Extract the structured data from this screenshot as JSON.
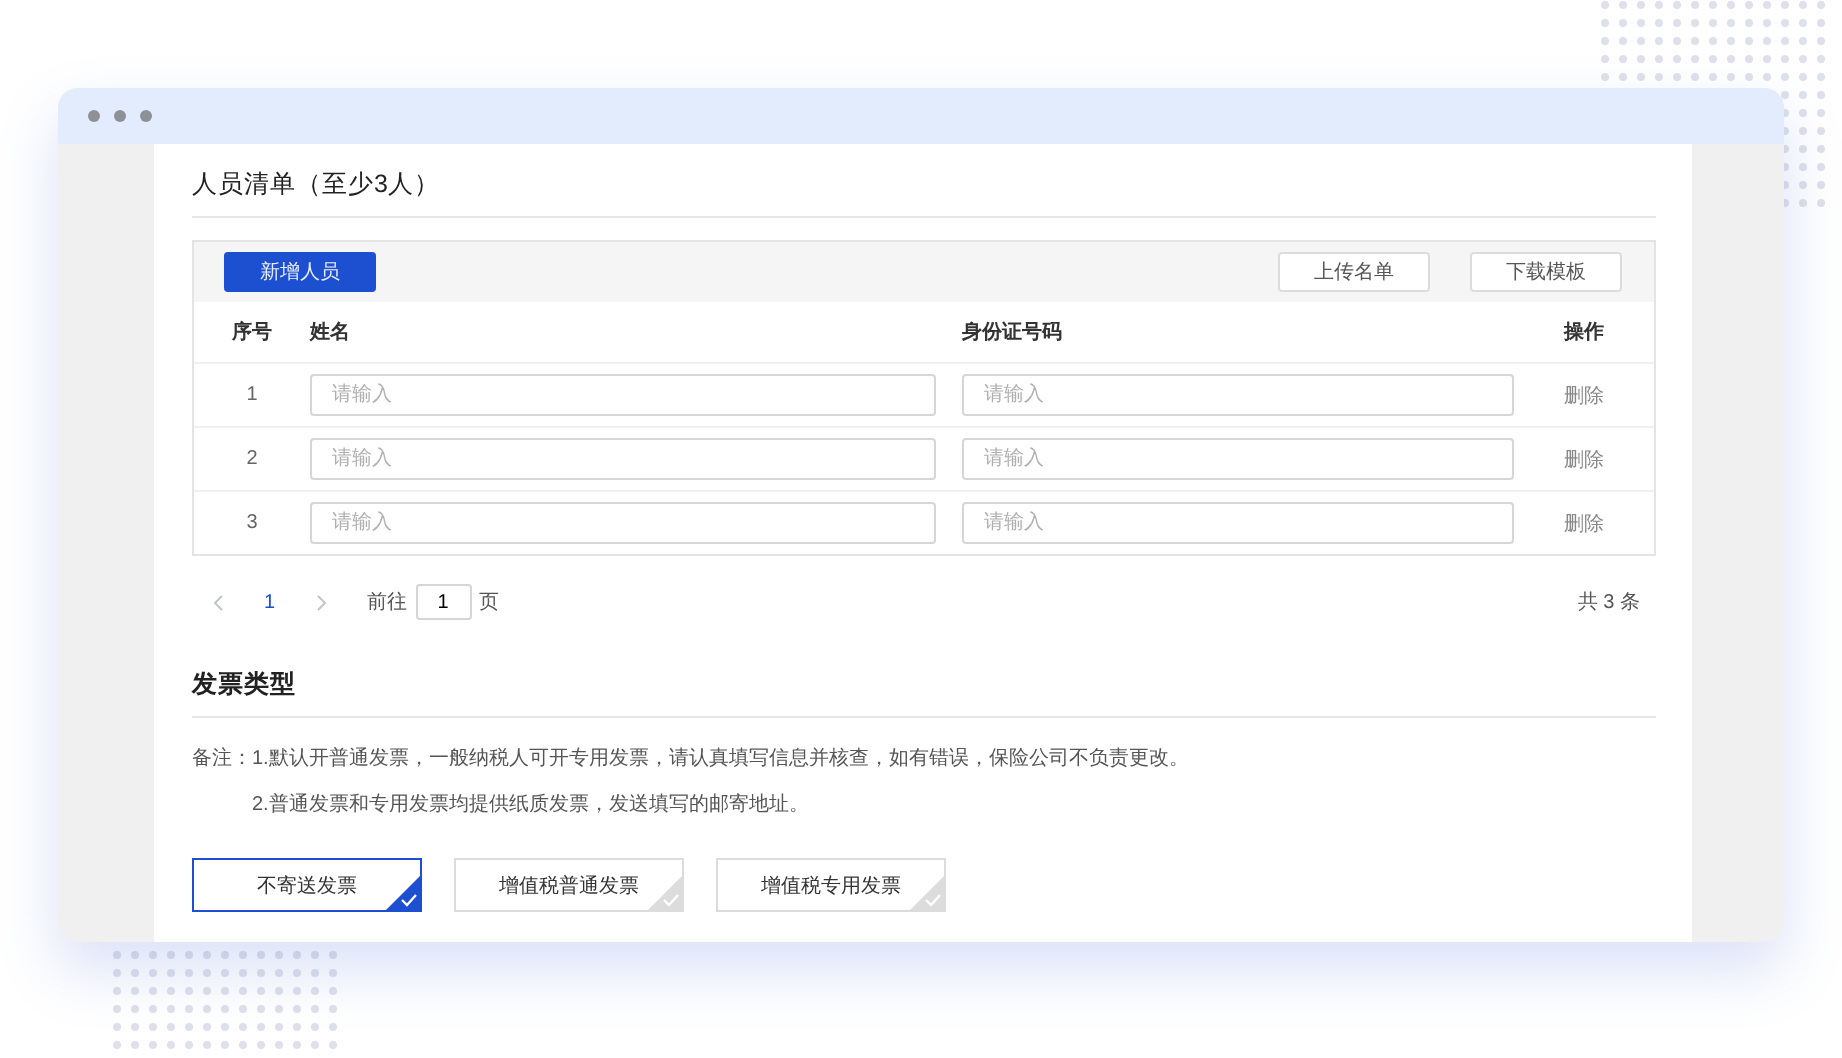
{
  "people_section": {
    "title": "人员清单（至少3人）",
    "toolbar": {
      "add_button": "新增人员",
      "upload_button": "上传名单",
      "download_button": "下载模板"
    },
    "table": {
      "columns": [
        "序号",
        "姓名",
        "身份证号码",
        "操作"
      ],
      "rows": [
        {
          "index": "1",
          "name": {
            "placeholder": "请输入"
          },
          "id_number": {
            "placeholder": "请输入"
          },
          "action": "删除"
        },
        {
          "index": "2",
          "name": {
            "placeholder": "请输入"
          },
          "id_number": {
            "placeholder": "请输入"
          },
          "action": "删除"
        },
        {
          "index": "3",
          "name": {
            "placeholder": "请输入"
          },
          "id_number": {
            "placeholder": "请输入"
          },
          "action": "删除"
        }
      ]
    },
    "pagination": {
      "pages": [
        {
          "label": "1",
          "selected": true
        }
      ],
      "goto_label": "前往",
      "goto_value": "1",
      "goto_suffix": "页",
      "total": "共 3 条"
    }
  },
  "invoice_section": {
    "title": "发票类型",
    "note_label": "备注：",
    "notes": [
      "1.默认开普通发票，一般纳税人可开专用发票，请认真填写信息并核查，如有错误，保险公司不负责更改。",
      "2.普通发票和专用发票均提供纸质发票，发送填写的邮寄地址。"
    ],
    "options": [
      {
        "label": "不寄送发票",
        "selected": true
      },
      {
        "label": "增值税普通发票",
        "selected": false
      },
      {
        "label": "增值税专用发票",
        "selected": false
      }
    ]
  }
}
